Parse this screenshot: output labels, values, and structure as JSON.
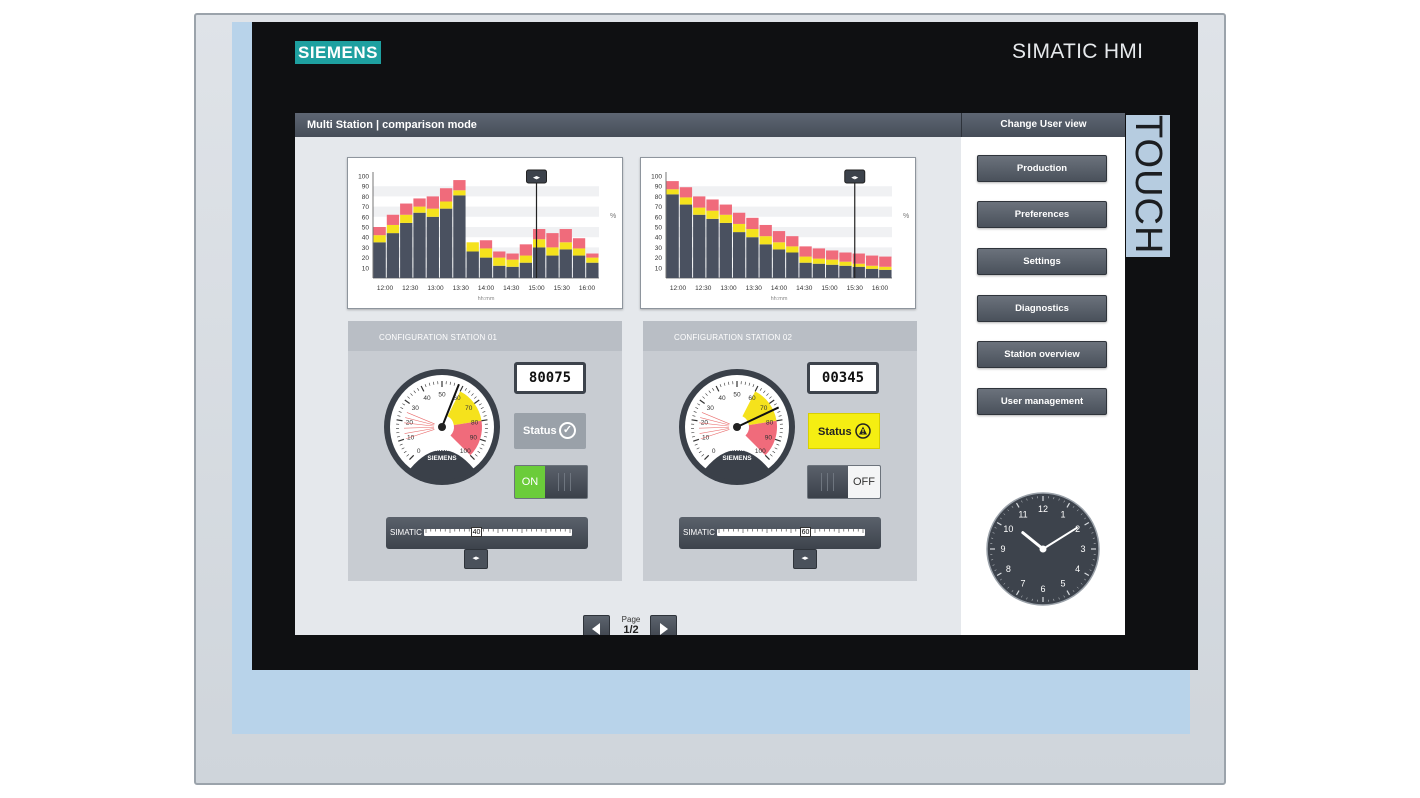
{
  "device": {
    "brand": "SIEMENS",
    "model": "SIMATIC HMI",
    "touch_label": "TOUCH"
  },
  "titlebar": {
    "title": "Multi Station | comparison mode",
    "right_title": "Change User view"
  },
  "charts": [
    {
      "y_ticks": [
        "100",
        "90",
        "80",
        "70",
        "60",
        "50",
        "40",
        "30",
        "20",
        "10"
      ],
      "x_ticks": [
        "12:00",
        "12:30",
        "13:00",
        "13:30",
        "14:00",
        "14:30",
        "15:00",
        "15:30",
        "16:00"
      ],
      "unit": "%",
      "xlabel": "hh:mm"
    },
    {
      "y_ticks": [
        "100",
        "90",
        "80",
        "70",
        "60",
        "50",
        "40",
        "30",
        "20",
        "10"
      ],
      "x_ticks": [
        "12:00",
        "12:30",
        "13:00",
        "13:30",
        "14:00",
        "14:30",
        "15:00",
        "15:30",
        "16:00"
      ],
      "unit": "%",
      "xlabel": "hh:mm"
    }
  ],
  "chart_data": [
    {
      "type": "bar",
      "stacked": true,
      "x": [
        "12:00",
        "12:30",
        "13:00",
        "13:30",
        "14:00",
        "14:30",
        "15:00",
        "15:30",
        "16:00"
      ],
      "ylim": [
        0,
        100
      ],
      "ylabel": "%",
      "xlabel": "hh:mm",
      "series": [
        {
          "color": "#4a5160",
          "values": [
            35,
            44,
            54,
            64,
            60,
            68,
            81,
            26,
            20,
            12,
            11,
            15,
            30,
            22,
            28,
            22,
            15
          ]
        },
        {
          "color": "#f5e21c",
          "values": [
            7,
            8,
            8,
            6,
            8,
            7,
            5,
            9,
            9,
            8,
            7,
            7,
            8,
            8,
            7,
            7,
            5
          ]
        },
        {
          "color": "#f06b7b",
          "values": [
            8,
            10,
            11,
            8,
            12,
            13,
            10,
            0,
            8,
            6,
            6,
            11,
            10,
            14,
            13,
            10,
            4
          ]
        }
      ],
      "cursor_x": "15:00"
    },
    {
      "type": "bar",
      "stacked": true,
      "x": [
        "12:00",
        "12:30",
        "13:00",
        "13:30",
        "14:00",
        "14:30",
        "15:00",
        "15:30",
        "16:00"
      ],
      "ylim": [
        0,
        100
      ],
      "ylabel": "%",
      "xlabel": "hh:mm",
      "series": [
        {
          "color": "#4a5160",
          "values": [
            82,
            72,
            62,
            58,
            54,
            45,
            40,
            33,
            28,
            25,
            15,
            14,
            13,
            12,
            11,
            9,
            8
          ]
        },
        {
          "color": "#f5e21c",
          "values": [
            5,
            7,
            7,
            8,
            8,
            8,
            8,
            8,
            7,
            6,
            6,
            5,
            5,
            4,
            3,
            3,
            3
          ]
        },
        {
          "color": "#f06b7b",
          "values": [
            8,
            10,
            11,
            11,
            10,
            11,
            11,
            11,
            11,
            10,
            10,
            10,
            9,
            9,
            10,
            10,
            10
          ]
        }
      ],
      "cursor_x": "15:30"
    }
  ],
  "stations": [
    {
      "title": "CONFIGURATION STATION 01",
      "counter": "80075",
      "status_label": "Status",
      "status_state": "ok",
      "toggle_state": "ON",
      "gauge_unit": "kWh",
      "gauge_brand": "SIEMENS",
      "gauge_value": 58,
      "slider_label": "SIMATIC",
      "slider_value": "40"
    },
    {
      "title": "CONFIGURATION STATION 02",
      "counter": "00345",
      "status_label": "Status",
      "status_state": "warning",
      "toggle_state": "OFF",
      "gauge_unit": "kWh",
      "gauge_brand": "SIEMENS",
      "gauge_value": 74,
      "slider_label": "SIMATIC",
      "slider_value": "60"
    }
  ],
  "gauge_ticks": [
    "0",
    "10",
    "20",
    "30",
    "40",
    "50",
    "60",
    "70",
    "80",
    "90",
    "100"
  ],
  "pager": {
    "label": "Page",
    "value": "1/2"
  },
  "nav": [
    "Production",
    "Preferences",
    "Settings",
    "Diagnostics",
    "Station overview",
    "User management"
  ],
  "clock": {
    "numbers": [
      "12",
      "1",
      "2",
      "3",
      "4",
      "5",
      "6",
      "7",
      "8",
      "9",
      "10",
      "11"
    ]
  },
  "colors": {
    "accent_teal": "#1ea0a0",
    "warning_yellow": "#f5ee12",
    "on_green": "#6bcc3a",
    "alarm_red": "#f06b7b",
    "bar_dark": "#4a5160"
  }
}
